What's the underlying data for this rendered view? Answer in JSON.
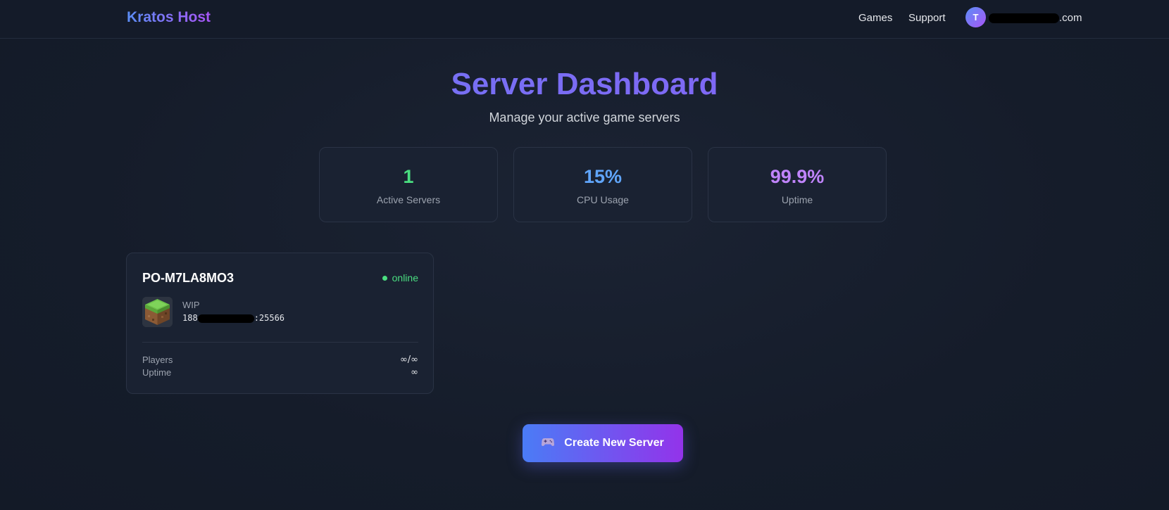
{
  "navbar": {
    "brand": "Kratos Host",
    "links": {
      "games": "Games",
      "support": "Support"
    },
    "user": {
      "avatar_initial": "T",
      "email_suffix": ".com"
    }
  },
  "header": {
    "title": "Server Dashboard",
    "subtitle": "Manage your active game servers"
  },
  "stats": [
    {
      "value": "1",
      "label": "Active Servers",
      "color": "#4ade80"
    },
    {
      "value": "15%",
      "label": "CPU Usage",
      "color": "#60a5fa"
    },
    {
      "value": "99.9%",
      "label": "Uptime",
      "color": "#c084fc"
    }
  ],
  "server": {
    "name": "PO-M7LA8MO3",
    "status": "online",
    "status_color": "#4ade80",
    "game_icon": "minecraft-grass-block-icon",
    "game": "WIP",
    "address_prefix": "188",
    "address_port": ":25566",
    "players_label": "Players",
    "players_value": "∞/∞",
    "uptime_label": "Uptime",
    "uptime_value": "∞"
  },
  "create_button": {
    "icon": "gamepad-icon",
    "label": "Create New Server"
  }
}
